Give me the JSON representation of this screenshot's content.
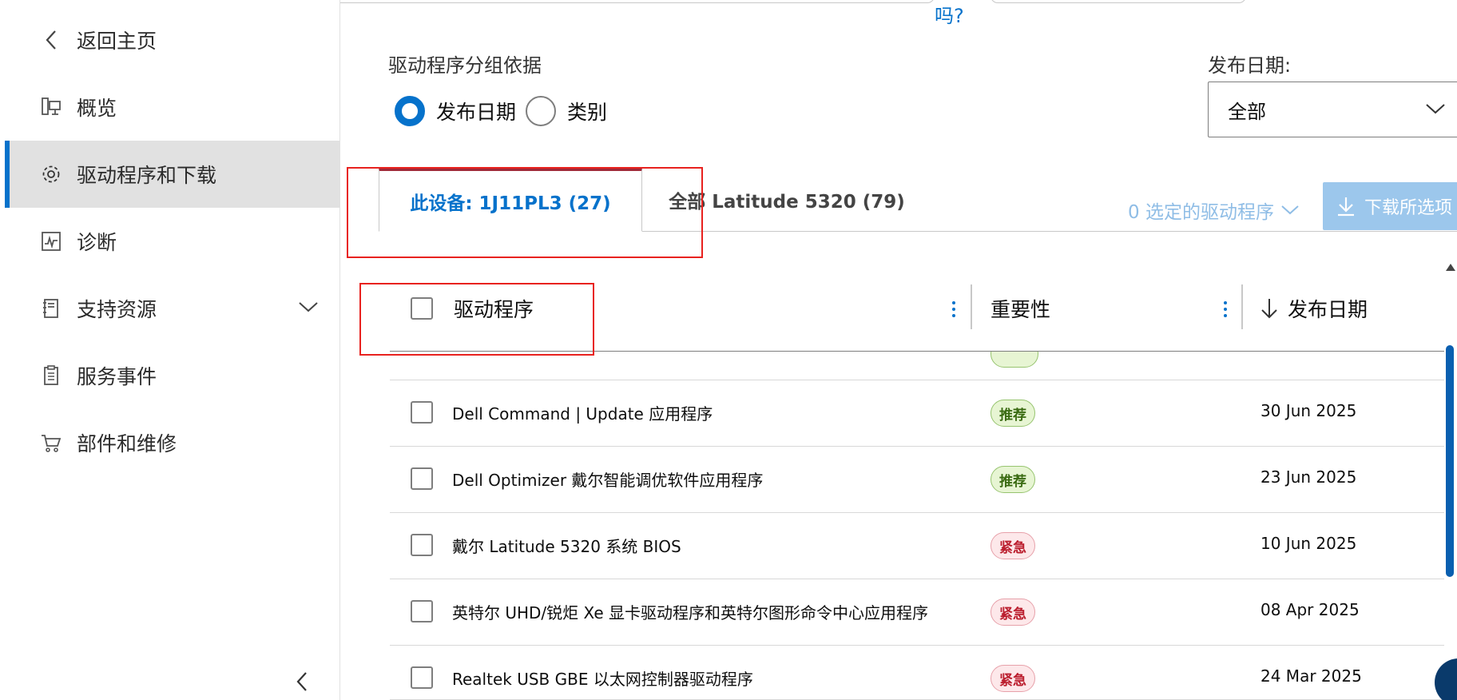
{
  "top": {
    "question_fragment": "吗?"
  },
  "sidebar": {
    "items": [
      {
        "label": "返回主页",
        "icon": "chevron-left-icon"
      },
      {
        "label": "概览",
        "icon": "computer-icon"
      },
      {
        "label": "驱动程序和下载",
        "icon": "gear-icon",
        "active": true
      },
      {
        "label": "诊断",
        "icon": "pulse-icon"
      },
      {
        "label": "支持资源",
        "icon": "book-icon"
      },
      {
        "label": "服务事件",
        "icon": "clipboard-icon"
      },
      {
        "label": "部件和维修",
        "icon": "cart-icon"
      }
    ]
  },
  "filters": {
    "group_label": "驱动程序分组依据",
    "radio_release_date": "发布日期",
    "radio_category": "类别",
    "date_label": "发布日期:",
    "date_value": "全部"
  },
  "tabs": {
    "this_device": "此设备: 1J11PL3 (27)",
    "all_model": "全部 Latitude 5320 (79)"
  },
  "actions": {
    "selected_count": "0 选定的驱动程序",
    "download_selected": "下载所选项"
  },
  "table": {
    "headers": {
      "driver": "驱动程序",
      "importance": "重要性",
      "release_date": "发布日期"
    },
    "rows": [
      {
        "name": "Dell Command | Update 应用程序",
        "badge": "推荐",
        "badge_type": "rec",
        "date": "30 Jun 2025"
      },
      {
        "name": "Dell Optimizer 戴尔智能调优软件应用程序",
        "badge": "推荐",
        "badge_type": "rec",
        "date": "23 Jun 2025"
      },
      {
        "name": "戴尔 Latitude 5320 系统 BIOS",
        "badge": "紧急",
        "badge_type": "urg",
        "date": "10 Jun 2025"
      },
      {
        "name": "英特尔 UHD/锐炬 Xe 显卡驱动程序和英特尔图形命令中心应用程序",
        "badge": "紧急",
        "badge_type": "urg",
        "date": "08 Apr 2025"
      },
      {
        "name": "Realtek USB GBE 以太网控制器驱动程序",
        "badge": "紧急",
        "badge_type": "urg",
        "date": "24 Mar 2025"
      }
    ]
  },
  "colors": {
    "accent": "#0672cb",
    "tab_top": "#9e2b3a",
    "annotation": "#e8221f"
  }
}
